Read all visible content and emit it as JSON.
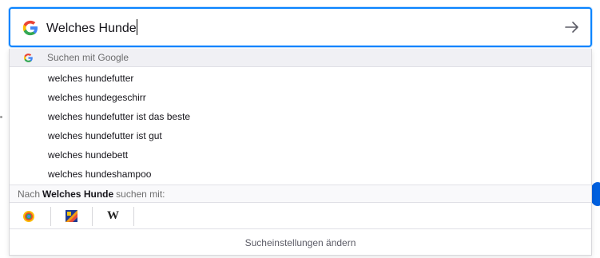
{
  "search": {
    "query": "Welches Hunde"
  },
  "dropdown": {
    "header_label": "Suchen mit Google",
    "suggestions": [
      "welches hundefutter",
      "welches hundegeschirr",
      "welches hundefutter ist das beste",
      "welches hundefutter ist gut",
      "welches hundebett",
      "welches hundeshampoo"
    ],
    "oneoff_prefix": "Nach",
    "oneoff_term": "Welches Hunde",
    "oneoff_suffix": "suchen mit:",
    "engines": [
      "google-icon",
      "amazon-icon",
      "wikipedia-icon"
    ],
    "wiki_label": "W",
    "settings_label": "Sucheinstellungen ändern"
  },
  "colors": {
    "focus_border": "#0a84ff",
    "header_bg": "#f0f0f4"
  }
}
